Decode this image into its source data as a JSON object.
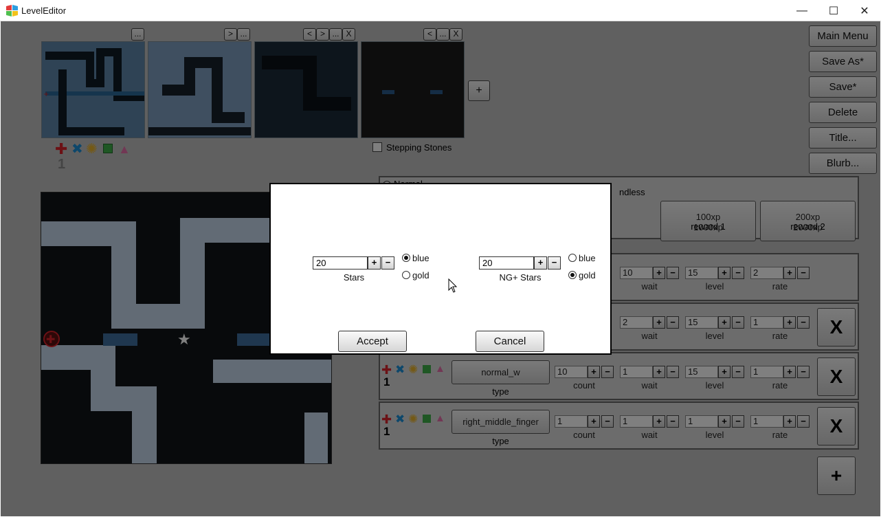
{
  "window": {
    "title": "LevelEditor",
    "minimize_glyph": "—",
    "maximize_glyph": "☐",
    "close_glyph": "✕"
  },
  "toolbar": {
    "thumb1": [
      "..."
    ],
    "thumb2": [
      ">",
      "..."
    ],
    "thumb3": [
      "<",
      ">",
      "...",
      "X"
    ],
    "thumb4": [
      "<",
      "...",
      "X"
    ],
    "add_thumb": "+"
  },
  "stepping_stones": "Stepping Stones",
  "thumb_icon_row_count": "1",
  "side_buttons": [
    "Main Menu",
    "Save As*",
    "Save*",
    "Delete",
    "Title...",
    "Blurb..."
  ],
  "mode_panel": {
    "normal_label": "Normal",
    "endless_label": "ndless",
    "rewards": [
      {
        "line1": "100xp",
        "line2": "1000xp",
        "caption": "reward 1"
      },
      {
        "line1": "200xp",
        "line2": "2000xp",
        "caption": "reward 2"
      }
    ]
  },
  "wave_rows": [
    {
      "type": "",
      "count": "",
      "wait": "10",
      "level": "15",
      "rate": "2"
    },
    {
      "type": "",
      "count": "",
      "wait": "2",
      "level": "15",
      "rate": "1"
    },
    {
      "type": "normal_w",
      "count": "10",
      "wait": "1",
      "level": "15",
      "rate": "1"
    },
    {
      "type": "right_middle_finger",
      "count": "1",
      "wait": "1",
      "level": "1",
      "rate": "1"
    }
  ],
  "labels": {
    "type": "type",
    "count": "count",
    "wait": "wait",
    "level": "level",
    "rate": "rate",
    "plus": "+",
    "minus": "−",
    "x": "X",
    "add": "+"
  },
  "dialog": {
    "stars_value": "20",
    "stars_label": "Stars",
    "ng_value": "20",
    "ng_label": "NG+ Stars",
    "blue": "blue",
    "gold": "gold",
    "stars_selected": "blue",
    "ng_selected": "gold",
    "accept": "Accept",
    "cancel": "Cancel"
  },
  "colors": {
    "overlay": "#000000",
    "red": "#d8232a",
    "blue": "#1b8fd6",
    "gold": "#e8b22a",
    "green": "#3fae49",
    "pink": "#e46ea8"
  }
}
